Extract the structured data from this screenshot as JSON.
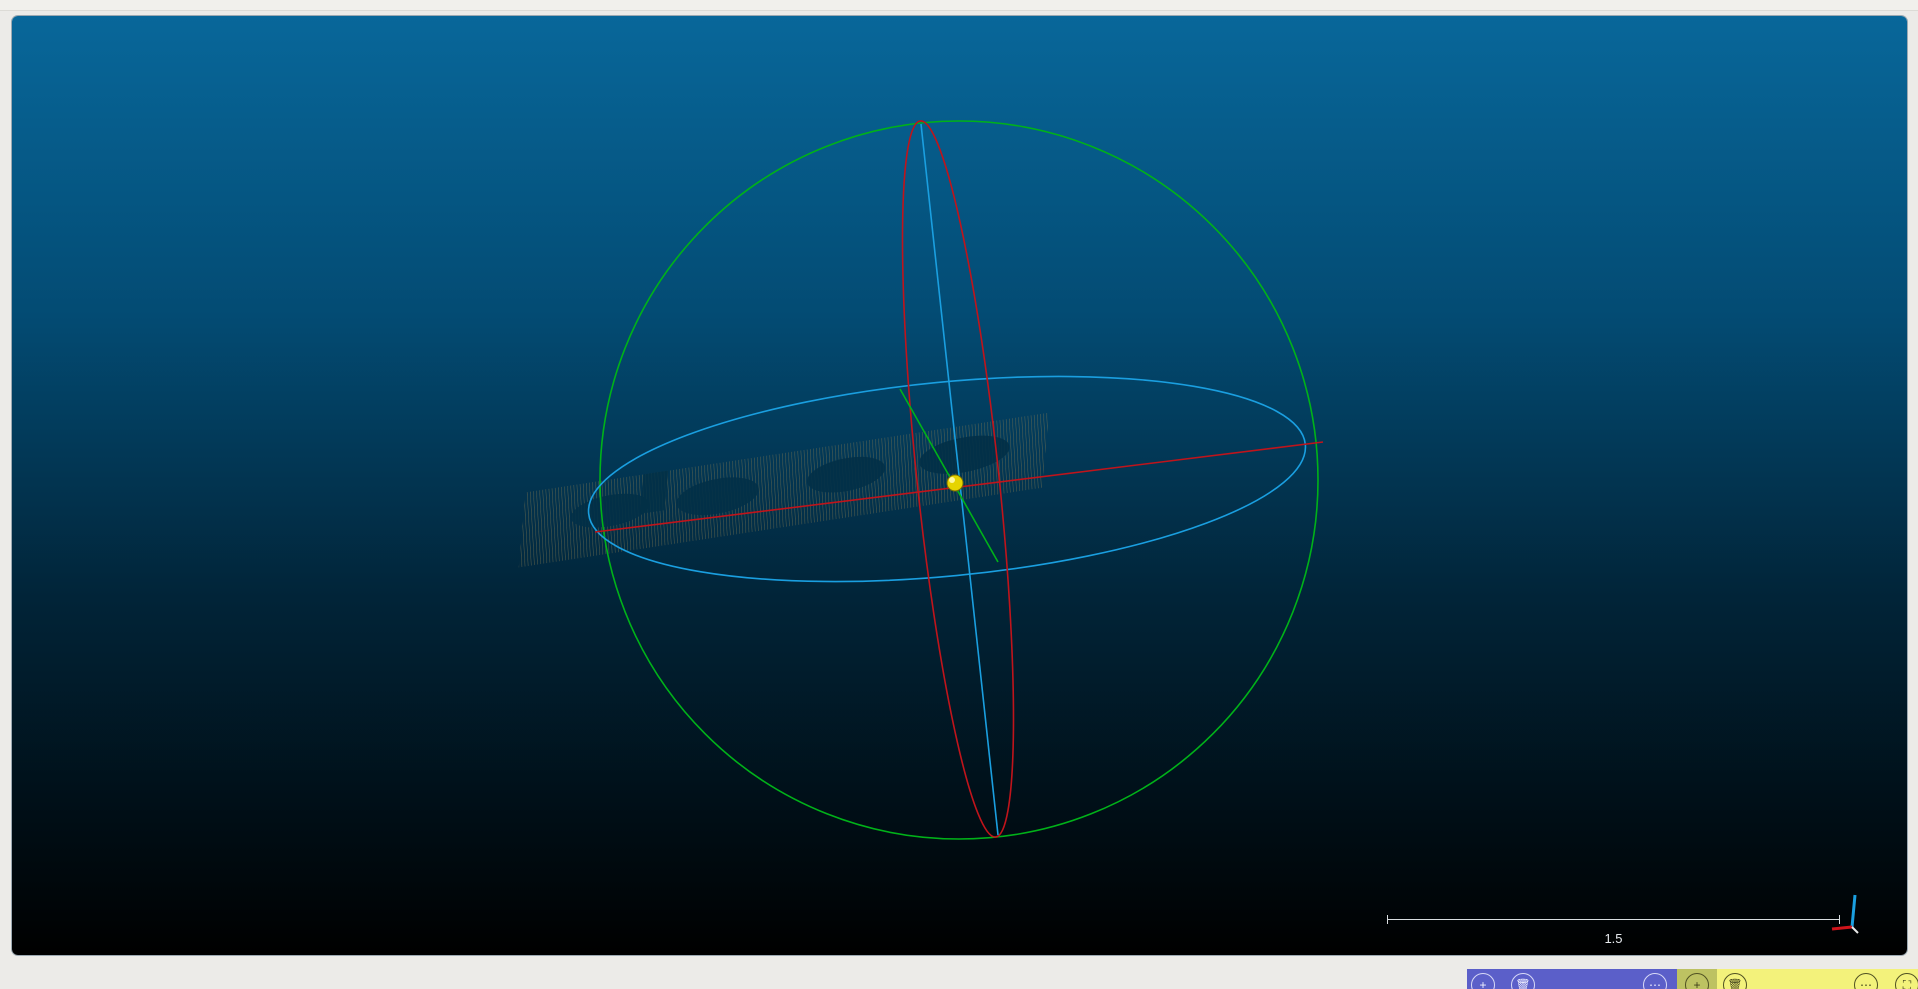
{
  "viewport": {
    "background_top": "#08679a",
    "background_bottom": "#000000"
  },
  "scene_colors": {
    "x_axis": "#c0141b",
    "y_axis": "#00b219",
    "z_axis": "#1a9fe0",
    "center_marker": "#e6d400",
    "text_points": "#8a7c4e"
  },
  "scale_bar": {
    "label": "1.5"
  },
  "axis_triad": {
    "icon": "xyz-axes-icon"
  },
  "bottom_toolbar": {
    "colors": {
      "blue": "#5b5fc9",
      "olive": "#bdc262",
      "yellow": "#f3f27b"
    },
    "buttons": [
      {
        "icon": "plus-icon",
        "glyph": "+"
      },
      {
        "icon": "trash-icon",
        "glyph": "🗑"
      },
      {
        "icon": "more-icon",
        "glyph": "⋯"
      },
      {
        "icon": "plus-icon",
        "glyph": "+"
      },
      {
        "icon": "trash-icon",
        "glyph": "🗑"
      },
      {
        "icon": "more-icon",
        "glyph": "⋯"
      },
      {
        "icon": "fullscreen-icon",
        "glyph": "⛶"
      }
    ]
  }
}
